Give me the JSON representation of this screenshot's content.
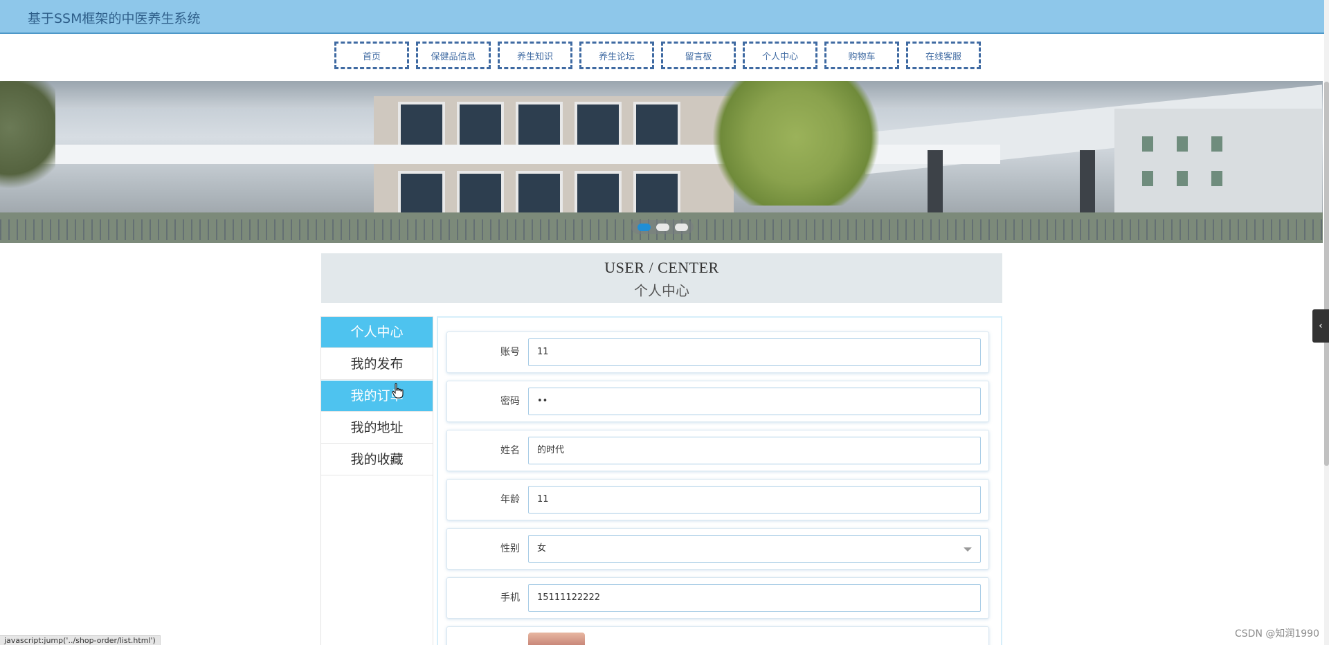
{
  "header": {
    "title": "基于SSM框架的中医养生系统"
  },
  "nav": {
    "items": [
      "首页",
      "保健品信息",
      "养生知识",
      "养生论坛",
      "留言板",
      "个人中心",
      "购物车",
      "在线客服"
    ]
  },
  "banner": {
    "slide_count": 3,
    "active_slide": 1
  },
  "section": {
    "title_en": "USER / CENTER",
    "title_cn": "个人中心"
  },
  "sidebar": {
    "items": [
      "个人中心",
      "我的发布",
      "我的订单",
      "我的地址",
      "我的收藏"
    ],
    "active_items": [
      "个人中心",
      "我的订单"
    ]
  },
  "form": {
    "account": {
      "label": "账号",
      "value": "11"
    },
    "password": {
      "label": "密码",
      "value": "••"
    },
    "name": {
      "label": "姓名",
      "value": "的时代"
    },
    "age": {
      "label": "年龄",
      "value": "11"
    },
    "gender": {
      "label": "性别",
      "value": "女"
    },
    "phone": {
      "label": "手机",
      "value": "15111122222"
    }
  },
  "status_bar": {
    "text": "javascript:jump('../shop-order/list.html')"
  },
  "watermark": {
    "text": "CSDN @知润1990"
  },
  "colors": {
    "header_bg": "#8ec7ea",
    "nav_border": "#3f6aa2",
    "sidebar_active": "#4ec3ef",
    "section_bg": "#e2e8eb"
  }
}
